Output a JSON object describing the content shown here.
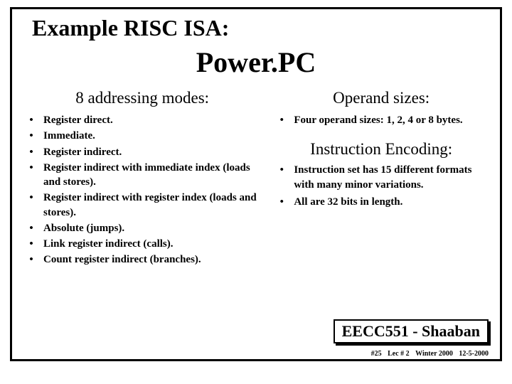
{
  "title": "Example RISC ISA:",
  "subtitle": "Power.PC",
  "left": {
    "heading": "8 addressing modes:",
    "items": [
      "Register direct.",
      "Immediate.",
      "Register indirect.",
      "Register indirect with immediate index (loads and stores).",
      "Register indirect with register index (loads and stores).",
      "Absolute (jumps).",
      "Link register indirect (calls).",
      "Count register indirect (branches)."
    ]
  },
  "right": {
    "heading1": "Operand sizes:",
    "operand_items": [
      "Four operand sizes: 1, 2, 4 or 8 bytes."
    ],
    "heading2": "Instruction Encoding:",
    "encoding_items": [
      "Instruction set has 15 different formats with many minor variations.",
      "All are 32 bits in length."
    ]
  },
  "course": "EECC551 - Shaaban",
  "footer": {
    "slide": "#25",
    "lec": "Lec # 2",
    "term": "Winter 2000",
    "date": "12-5-2000"
  }
}
